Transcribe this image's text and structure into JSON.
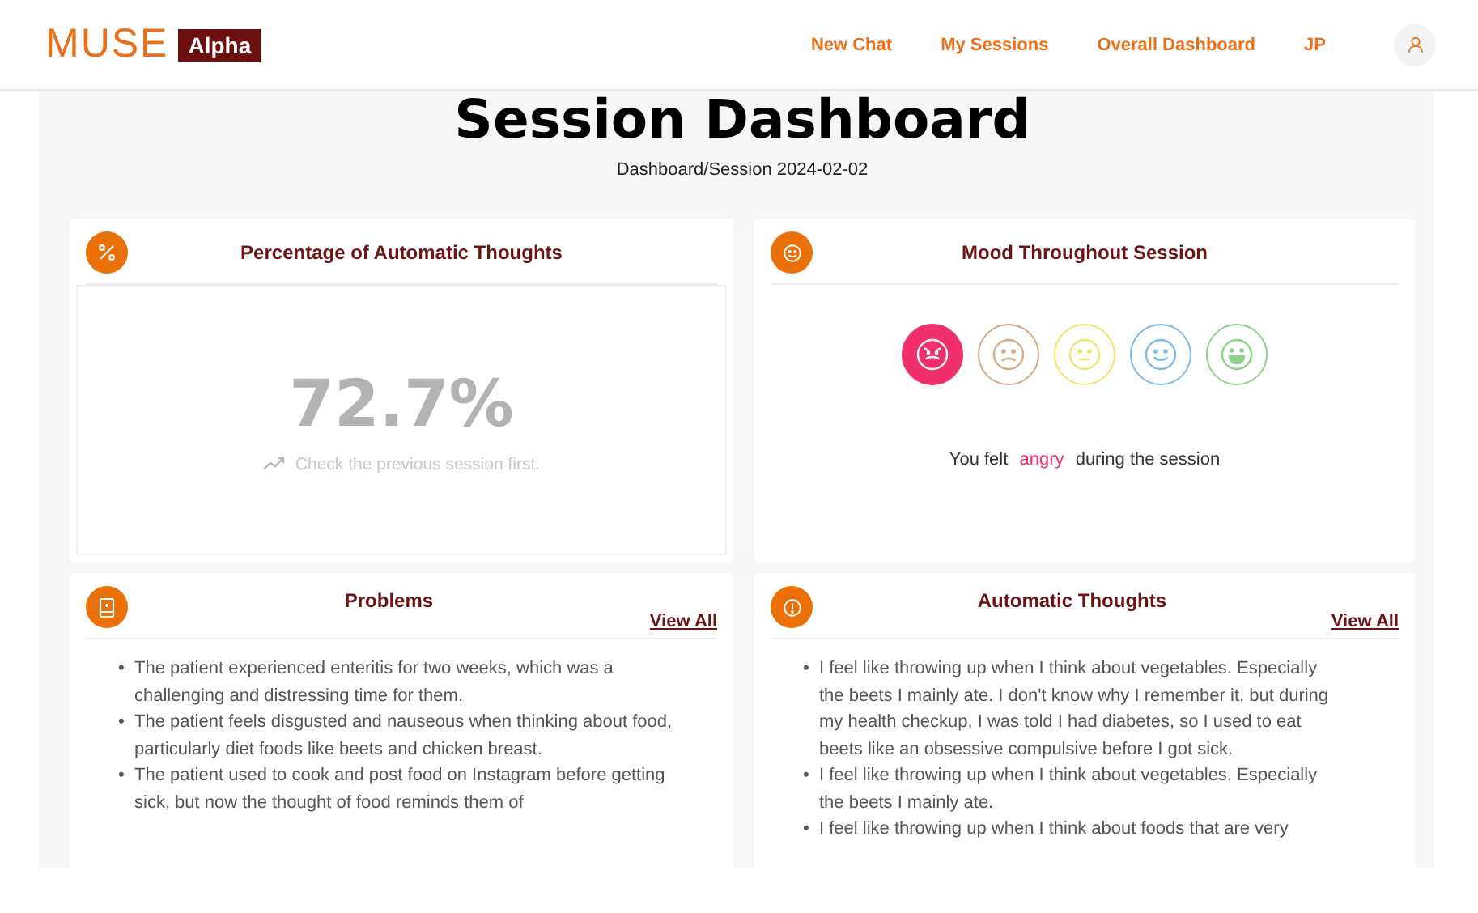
{
  "header": {
    "logo": "MUSE",
    "badge": "Alpha",
    "nav": [
      {
        "label": "New Chat"
      },
      {
        "label": "My Sessions"
      },
      {
        "label": "Overall Dashboard"
      },
      {
        "label": "JP"
      }
    ]
  },
  "page": {
    "title": "Session Dashboard",
    "breadcrumb": "Dashboard/Session 2024-02-02"
  },
  "percentage_card": {
    "title": "Percentage of Automatic Thoughts",
    "value": "72.7%",
    "hint": "Check the previous session first."
  },
  "mood_card": {
    "title": "Mood Throughout Session",
    "moods": [
      {
        "kind": "angry",
        "color": "#f0306a",
        "selected": true
      },
      {
        "kind": "sad",
        "color": "#d4a98a",
        "selected": false
      },
      {
        "kind": "neutral",
        "color": "#f2e36a",
        "selected": false
      },
      {
        "kind": "smile",
        "color": "#7bbbe6",
        "selected": false
      },
      {
        "kind": "grin",
        "color": "#8fd08a",
        "selected": false
      }
    ],
    "sentence_before": "You felt",
    "mood_word": "angry",
    "sentence_after": "during the session"
  },
  "problems_card": {
    "title": "Problems",
    "link": "View All",
    "items": [
      {
        "marker": "•",
        "text": "The patient experienced enteritis for two weeks, which was a challenging and distressing time for them."
      },
      {
        "marker": "•",
        "text": "The patient feels disgusted and nauseous when thinking about food, particularly diet foods like beets and chicken breast."
      },
      {
        "marker": "•",
        "text": "The patient used to cook and post food on Instagram before getting sick, but now the thought of food reminds them of"
      }
    ]
  },
  "thoughts_card": {
    "title": "Automatic Thoughts",
    "link": "View All",
    "items": [
      {
        "marker": "•",
        "text": "I feel like throwing up when I think about vegetables. Especially the beets I mainly ate. I don't know why I remember it, but during my health checkup, I was told I had diabetes, so I used to eat beets like an obsessive compulsive before I got sick."
      },
      {
        "marker": "•",
        "text": "I feel like throwing up when I think about vegetables. Especially the beets I mainly ate."
      },
      {
        "marker": "•",
        "text": "I feel like throwing up when I think about foods that are very"
      }
    ]
  }
}
